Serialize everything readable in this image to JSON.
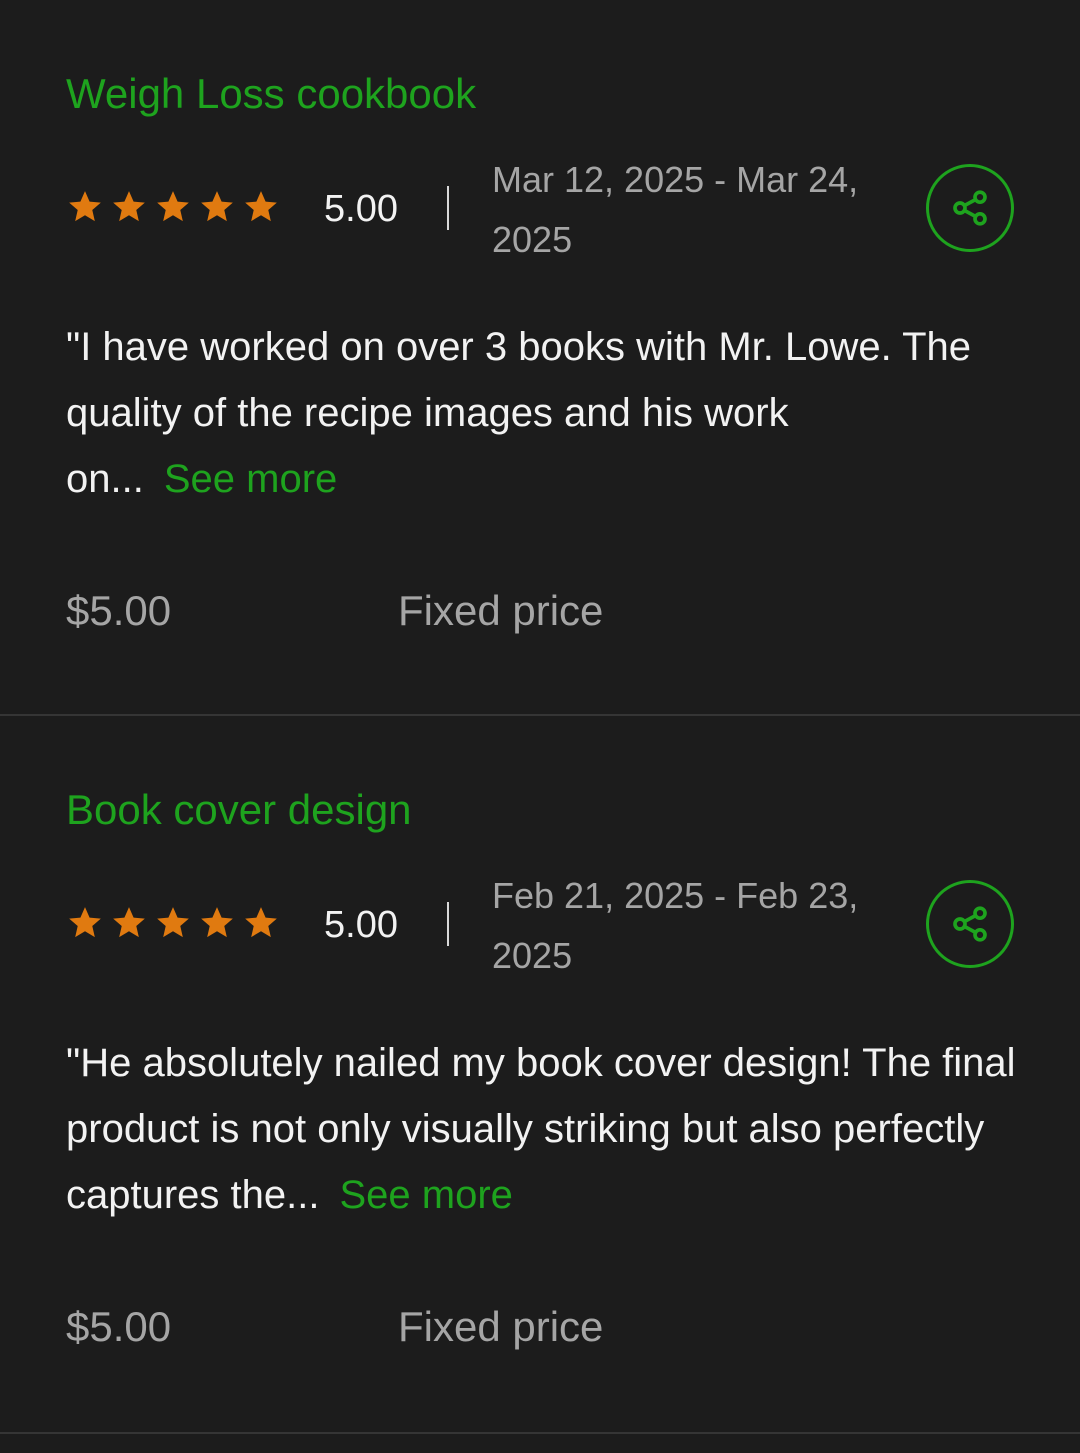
{
  "colors": {
    "background": "#1c1c1c",
    "accent_green": "#1ea31e",
    "star_orange": "#e07a10",
    "muted_text": "#a5a5a5",
    "primary_text": "#f2f2f2"
  },
  "reviews": [
    {
      "title": "Weigh Loss cookbook",
      "stars": 5,
      "rating": "5.00",
      "dates": "Mar 12, 2025 - Mar 24, 2025",
      "excerpt": "\"I have worked on over 3 books with Mr. Lowe. The quality of the recipe images and his work on...",
      "see_more": "See more",
      "price": "$5.00",
      "price_type": "Fixed price",
      "share_icon": "share-icon"
    },
    {
      "title": "Book cover design",
      "stars": 5,
      "rating": "5.00",
      "dates": "Feb 21, 2025 - Feb 23, 2025",
      "excerpt": "\"He absolutely nailed my book cover design! The final product is not only visually striking but also perfectly captures the...",
      "see_more": "See more",
      "price": "$5.00",
      "price_type": "Fixed price",
      "share_icon": "share-icon"
    }
  ]
}
